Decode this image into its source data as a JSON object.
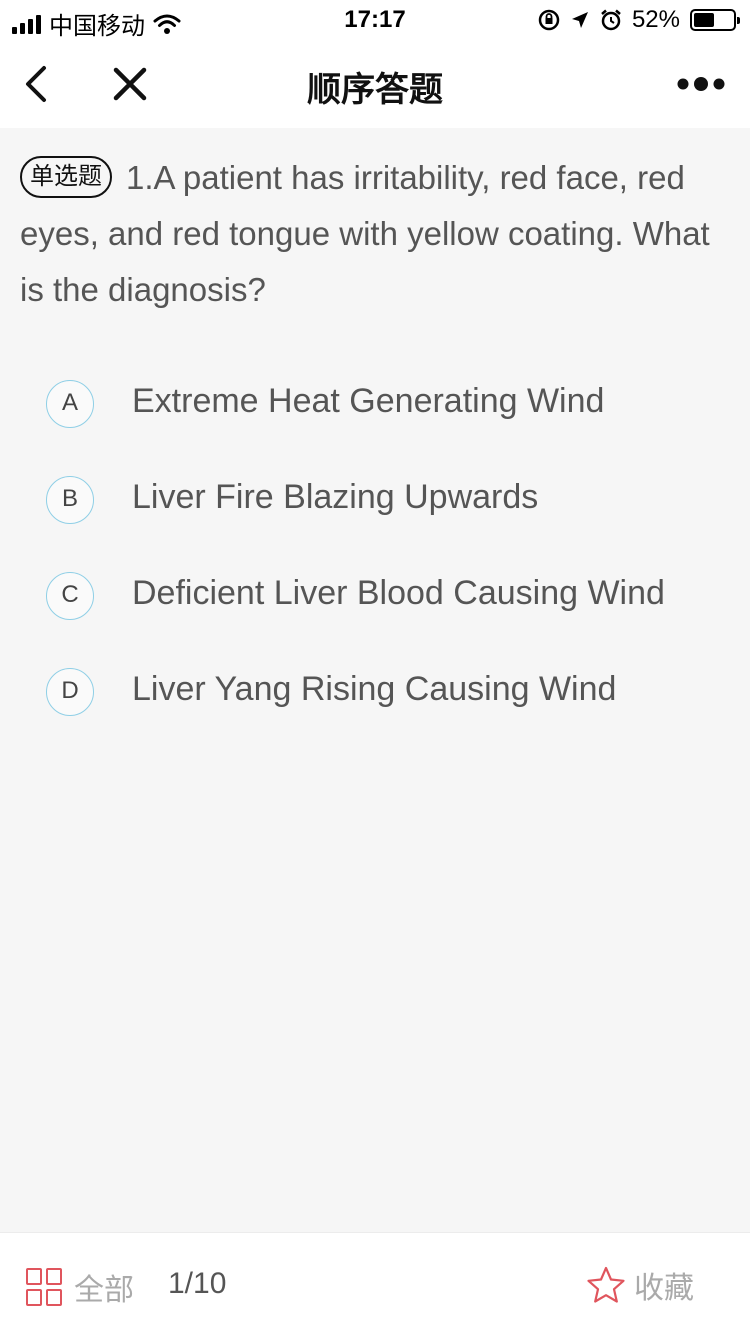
{
  "status_bar": {
    "carrier": "中国移动",
    "time": "17:17",
    "battery_percent": "52%",
    "battery_level": 0.52,
    "icons": [
      "signal-icon",
      "wifi-icon",
      "rotation-lock-icon",
      "location-icon",
      "alarm-icon",
      "battery-icon"
    ]
  },
  "nav": {
    "title": "顺序答题",
    "icons": [
      "back-icon",
      "close-icon",
      "more-icon"
    ]
  },
  "question": {
    "type_badge": "单选题",
    "text": "1.A patient has irritability, red face, red eyes, and red tongue with yellow coating. What is the diagnosis?"
  },
  "options": [
    {
      "letter": "A",
      "text": "Extreme Heat Generating Wind"
    },
    {
      "letter": "B",
      "text": "Liver Fire Blazing Upwards"
    },
    {
      "letter": "C",
      "text": "Deficient Liver Blood Causing Wind"
    },
    {
      "letter": "D",
      "text": "Liver Yang Rising Causing Wind"
    }
  ],
  "bottom_bar": {
    "all_label": "全部",
    "progress": "1/10",
    "favorite_label": "收藏",
    "accent_color": "#e0555d",
    "icons": [
      "grid-icon",
      "star-icon"
    ]
  },
  "colors": {
    "option_circle_border": "#8fcfe6",
    "background": "#f6f6f6"
  }
}
